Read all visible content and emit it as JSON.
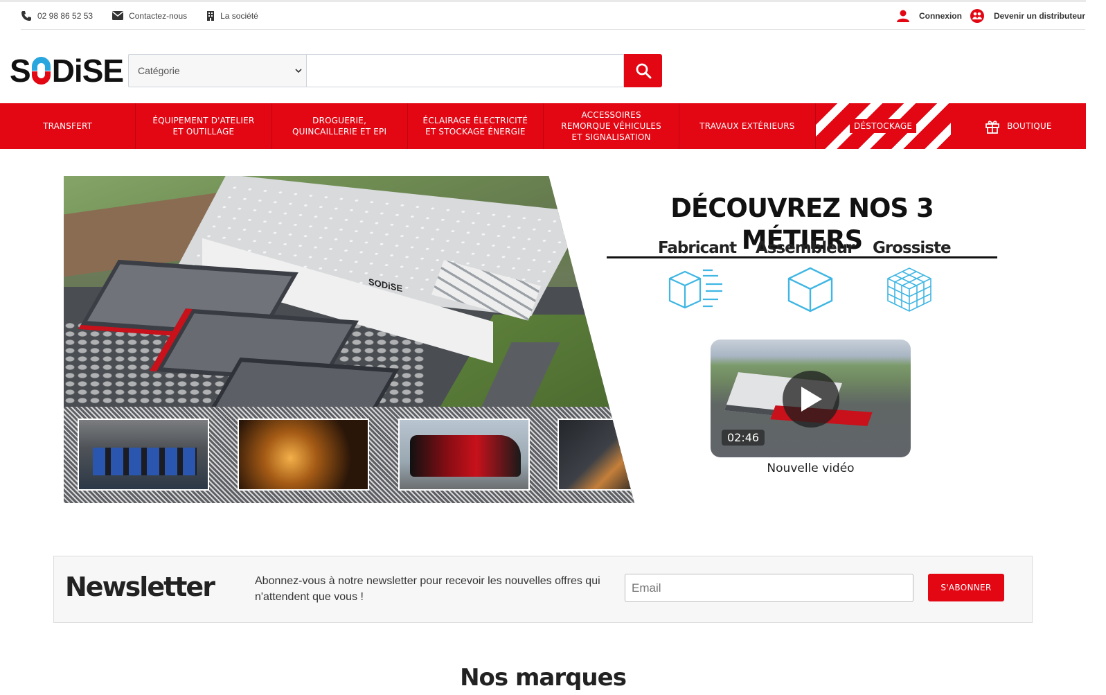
{
  "topbar": {
    "phone": "02 98 86 52 53",
    "contact": "Contactez-nous",
    "company": "La société",
    "login": "Connexion",
    "distributor": "Devenir un distributeur"
  },
  "header": {
    "logo_text_left": "S",
    "logo_text_right": "DiSE",
    "category_placeholder": "Catégorie",
    "search_value": ""
  },
  "nav": {
    "items": [
      {
        "label": "TRANSFERT"
      },
      {
        "label": "ÉQUIPEMENT D'ATELIER ET OUTILLAGE"
      },
      {
        "label": "DROGUERIE, QUINCAILLERIE ET EPI"
      },
      {
        "label": "ÉCLAIRAGE ÉLECTRICITÉ ET STOCKAGE ÉNERGIE"
      },
      {
        "label": "ACCESSOIRES REMORQUE VÉHICULES ET SIGNALISATION"
      },
      {
        "label": "TRAVAUX EXTÉRIEURS"
      },
      {
        "label": "DÉSTOCKAGE"
      },
      {
        "label": "BOUTIQUE"
      }
    ]
  },
  "hero": {
    "building_sign": "SODiSE",
    "title": "DÉCOUVREZ NOS 3 MÉTIERS",
    "metiers": [
      "Fabricant",
      "Assembleur",
      "Grossiste"
    ],
    "video_duration": "02:46",
    "video_caption": "Nouvelle vidéo"
  },
  "newsletter": {
    "title": "Newsletter",
    "text": "Abonnez-vous à notre newsletter pour recevoir les nouvelles offres qui n'attendent que vous !",
    "email_placeholder": "Email",
    "button": "S'ABONNER"
  },
  "brands_title": "Nos marques",
  "colors": {
    "brand_red": "#e30613",
    "brand_blue": "#2aa6df",
    "icon_blue": "#3fb6e3"
  }
}
